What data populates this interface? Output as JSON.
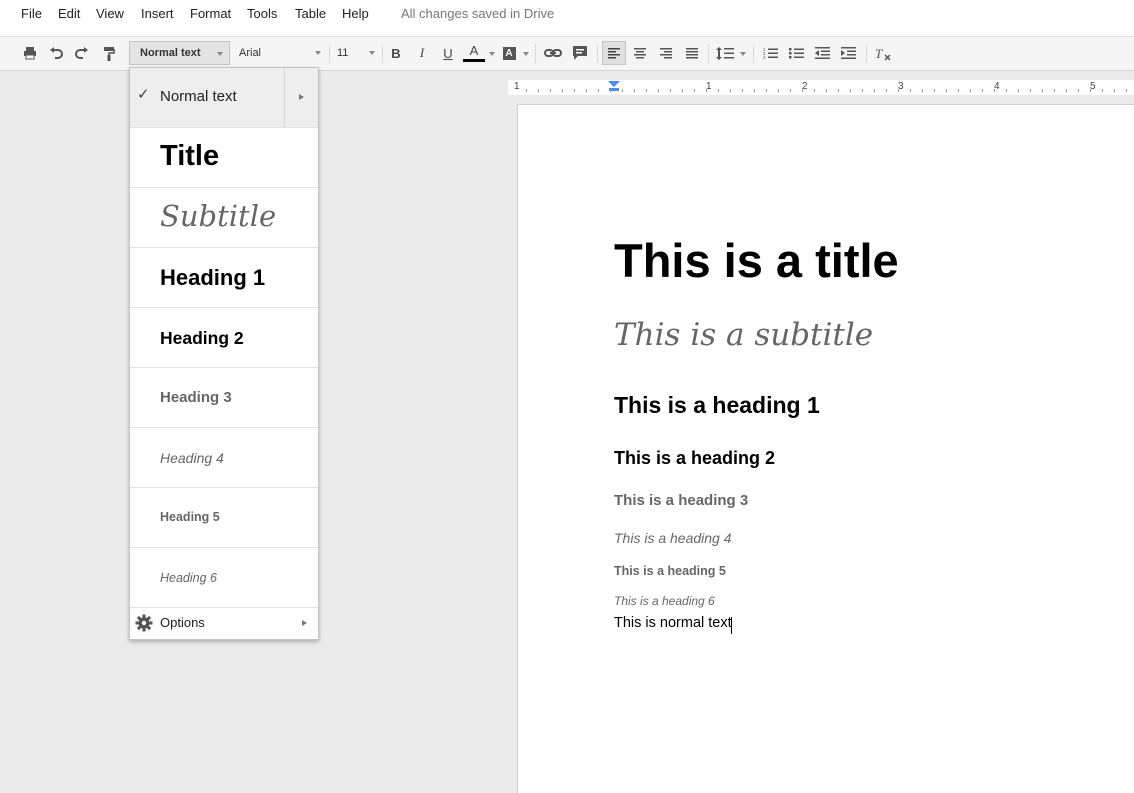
{
  "menubar": {
    "items": [
      "File",
      "Edit",
      "View",
      "Insert",
      "Format",
      "Tools",
      "Table",
      "Help"
    ],
    "status": "All changes saved in Drive"
  },
  "toolbar": {
    "style_value": "Normal text",
    "font_value": "Arial",
    "size_value": "11",
    "bold_label": "B",
    "italic_label": "I",
    "underline_label": "U",
    "text_color_label": "A",
    "text_color": "#000000",
    "highlight_label": "A",
    "icons": [
      "print-icon",
      "undo-icon",
      "redo-icon",
      "paint-format-icon",
      "link-icon",
      "comment-icon",
      "align-left-icon",
      "align-center-icon",
      "align-right-icon",
      "align-justify-icon",
      "line-spacing-icon",
      "numbered-list-icon",
      "bulleted-list-icon",
      "decrease-indent-icon",
      "increase-indent-icon",
      "clear-formatting-icon"
    ]
  },
  "ruler": {
    "numbers": [
      "1",
      "1",
      "2",
      "3",
      "4",
      "5"
    ]
  },
  "style_menu": {
    "normal": "Normal text",
    "check": "✓",
    "title": "Title",
    "subtitle": "Subtitle",
    "h1": "Heading 1",
    "h2": "Heading 2",
    "h3": "Heading 3",
    "h4": "Heading 4",
    "h5": "Heading 5",
    "h6": "Heading 6",
    "options": "Options"
  },
  "document": {
    "title": "This is a title",
    "subtitle": "This is a subtitle",
    "heading1": "This is a heading 1",
    "heading2": "This is a heading 2",
    "heading3": "This is a heading 3",
    "heading4": "This is a heading 4",
    "heading5": "This is a heading 5",
    "heading6": "This is a heading 6",
    "normal": "This is normal text"
  },
  "colors": {
    "menu_highlight": "#eeeeee",
    "heading_grey": "#666666",
    "background": "#ebebeb"
  }
}
